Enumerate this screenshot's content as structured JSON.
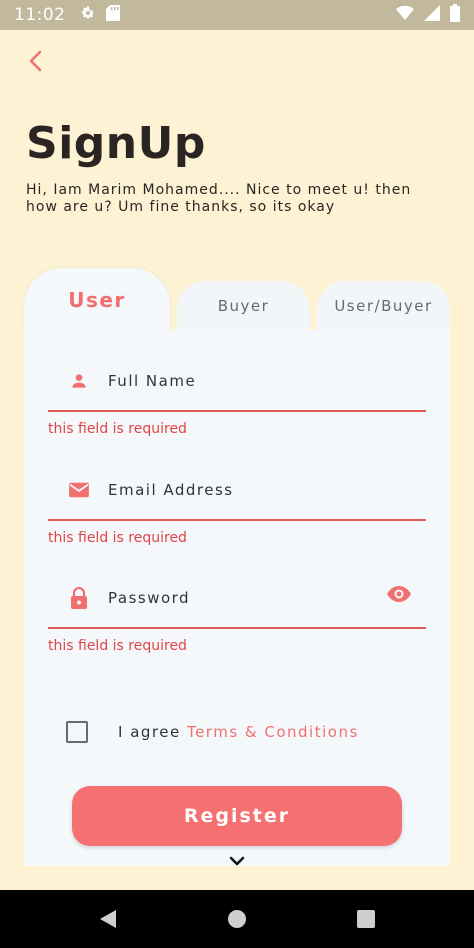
{
  "status_bar": {
    "time": "11:02",
    "icons": [
      "settings-icon",
      "sd-card-icon",
      "wifi-icon",
      "signal-icon",
      "battery-icon"
    ]
  },
  "header": {
    "title": "SignUp",
    "subtitle": "Hi, Iam Marim Mohamed.... Nice to meet u! then how are u? Um fine thanks, so its okay"
  },
  "tabs": [
    {
      "label": "User",
      "selected": true
    },
    {
      "label": "Buyer",
      "selected": false
    },
    {
      "label": "User/Buyer",
      "selected": false
    }
  ],
  "form": {
    "full_name": {
      "placeholder": "Full Name",
      "error": "this field is required",
      "icon": "person-icon"
    },
    "email": {
      "placeholder": "Email Address",
      "error": "this field is required",
      "icon": "mail-icon"
    },
    "password": {
      "placeholder": "Password",
      "error": "this field is required",
      "icon": "lock-icon"
    },
    "agree_text": "I agree ",
    "terms_link": "Terms & Conditions",
    "register_label": "Register"
  },
  "colors": {
    "background": "#fdf3d4",
    "accent": "#f57171",
    "error": "#e04545",
    "card": "#f5f8fb"
  }
}
